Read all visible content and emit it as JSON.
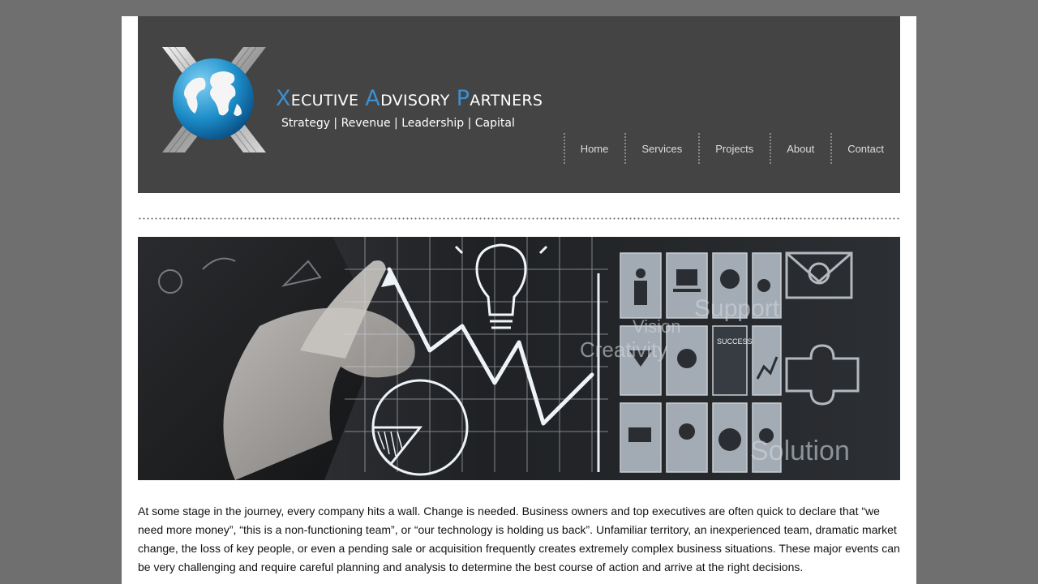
{
  "brand": {
    "name_words": [
      {
        "cap": "X",
        "rest": "ECUTIVE"
      },
      {
        "cap": "A",
        "rest": "DVISORY"
      },
      {
        "cap": "P",
        "rest": "ARTNERS"
      }
    ],
    "tagline": "Strategy | Revenue | Leadership | Capital",
    "accent_color": "#3c8fd0"
  },
  "nav": {
    "items": [
      "Home",
      "Services",
      "Projects",
      "About",
      "Contact"
    ]
  },
  "banner": {
    "labels": [
      "SUCCESS",
      "Vision",
      "Creativity",
      "Support",
      "Solution"
    ]
  },
  "main": {
    "intro": "At some stage in the journey, every company hits a wall. Change is needed. Business owners and top executives are often quick to declare that “we need more money”, “this is a non-functioning team”, or “our technology is holding us back”. Unfamiliar territory, an inexperienced team, dramatic market change, the loss of key people, or even a pending sale or acquisition frequently creates extremely complex business situations. These major events can be very challenging and require careful planning and analysis to determine the best course of action and arrive at the right decisions."
  }
}
